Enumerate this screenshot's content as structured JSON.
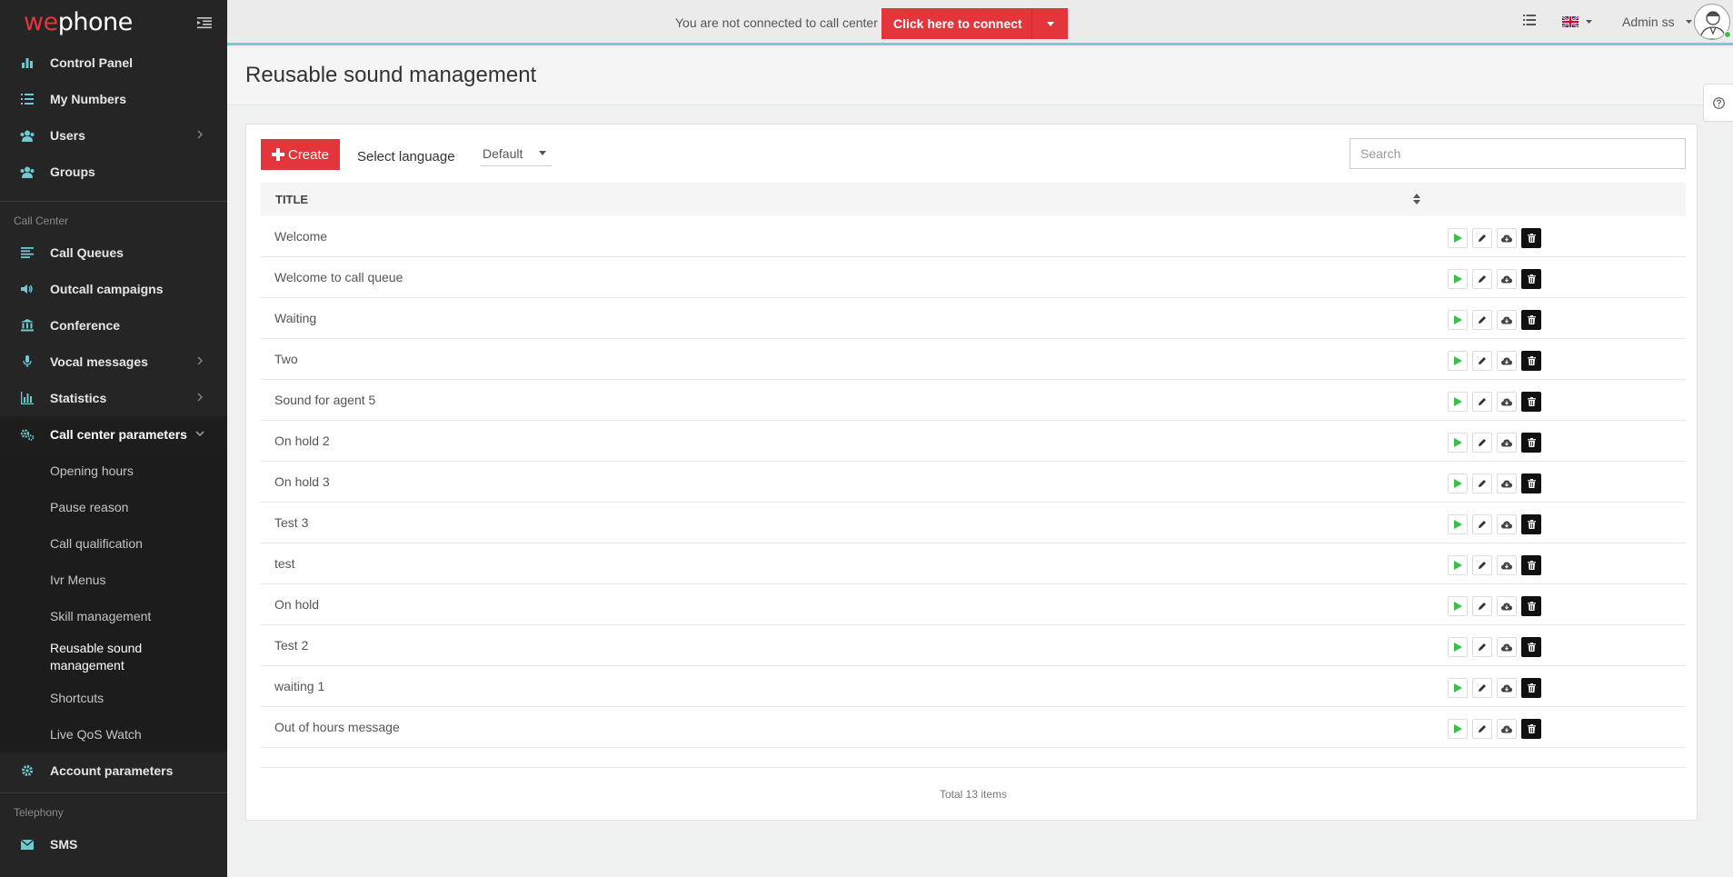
{
  "brand": {
    "logo_prefix": "we",
    "logo_suffix": "phone"
  },
  "sidebar": {
    "top_items": [
      {
        "label": "Control Panel"
      },
      {
        "label": "My Numbers"
      },
      {
        "label": "Users"
      },
      {
        "label": "Groups"
      }
    ],
    "section_call_center": "Call Center",
    "call_center_items": [
      {
        "label": "Call Queues"
      },
      {
        "label": "Outcall campaigns"
      },
      {
        "label": "Conference"
      },
      {
        "label": "Vocal messages"
      },
      {
        "label": "Statistics"
      },
      {
        "label": "Call center parameters"
      }
    ],
    "sub_items": [
      {
        "label": "Opening hours"
      },
      {
        "label": "Pause reason"
      },
      {
        "label": "Call qualification"
      },
      {
        "label": "Ivr Menus"
      },
      {
        "label": "Skill management"
      },
      {
        "label": "Reusable sound management"
      },
      {
        "label": "Shortcuts"
      },
      {
        "label": "Live QoS Watch"
      }
    ],
    "account_parameters": "Account parameters",
    "section_telephony": "Telephony",
    "sms": "SMS"
  },
  "topbar": {
    "notice": "You are not connected to call center",
    "connect_label": "Click here to connect",
    "user_name": "Admin ss"
  },
  "page": {
    "title": "Reusable sound management"
  },
  "toolbar": {
    "create_label": "Create",
    "select_language_label": "Select language",
    "language_value": "Default",
    "search_placeholder": "Search"
  },
  "table": {
    "header_title": "TITLE",
    "rows": [
      "Welcome",
      "Welcome to call queue",
      "Waiting",
      "Two",
      "Sound for agent 5",
      "On hold 2",
      "On hold 3",
      "Test 3",
      "test",
      "On hold",
      "Test 2",
      "waiting 1",
      "Out of hours message"
    ],
    "total": "Total 13 items"
  },
  "colors": {
    "accent": "#e5353c",
    "sidebar_bg": "#252525",
    "icon_teal": "#6fc9d0",
    "play_green": "#3cbf4a"
  }
}
